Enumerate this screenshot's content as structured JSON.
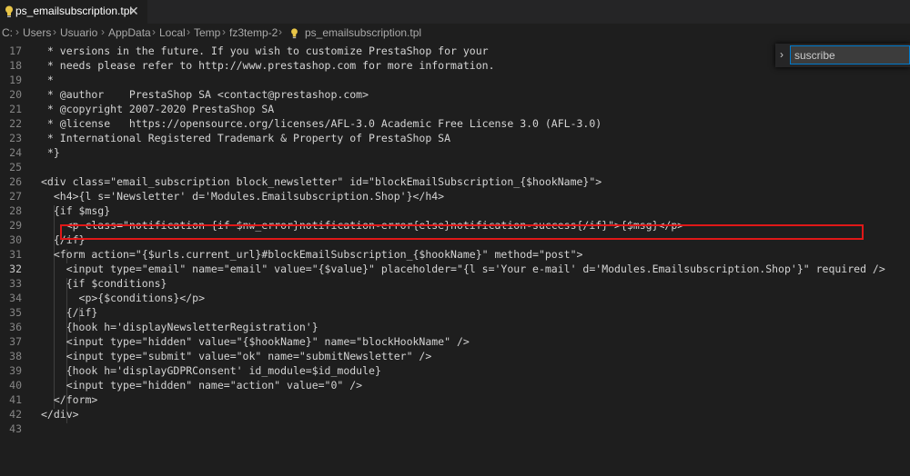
{
  "tab": {
    "label": "ps_emailsubscription.tpl",
    "close": "✕"
  },
  "breadcrumb": [
    "C:",
    "Users",
    "Usuario",
    "AppData",
    "Local",
    "Temp",
    "fz3temp-2",
    "ps_emailsubscription.tpl"
  ],
  "find": {
    "value": "suscribe",
    "toggle": "›"
  },
  "lines": [
    {
      "n": "17",
      "text": " * versions in the future. If you wish to customize PrestaShop for your"
    },
    {
      "n": "18",
      "text": " * needs please refer to http://www.prestashop.com for more information."
    },
    {
      "n": "19",
      "text": " *"
    },
    {
      "n": "20",
      "text": " * @author    PrestaShop SA <contact@prestashop.com>"
    },
    {
      "n": "21",
      "text": " * @copyright 2007-2020 PrestaShop SA"
    },
    {
      "n": "22",
      "text": " * @license   https://opensource.org/licenses/AFL-3.0 Academic Free License 3.0 (AFL-3.0)"
    },
    {
      "n": "23",
      "text": " * International Registered Trademark & Property of PrestaShop SA"
    },
    {
      "n": "24",
      "text": " *}"
    },
    {
      "n": "25",
      "text": ""
    },
    {
      "n": "26",
      "text": "<div class=\"email_subscription block_newsletter\" id=\"blockEmailSubscription_{$hookName}\">"
    },
    {
      "n": "27",
      "text": "  <h4>{l s='Newsletter' d='Modules.Emailsubscription.Shop'}</h4>"
    },
    {
      "n": "28",
      "text": "  {if $msg}"
    },
    {
      "n": "29",
      "text": "    <p class=\"notification {if $nw_error}notification-error{else}notification-success{/if}\">{$msg}</p>"
    },
    {
      "n": "30",
      "text": "  {/if}"
    },
    {
      "n": "31",
      "text": "  <form action=\"{$urls.current_url}#blockEmailSubscription_{$hookName}\" method=\"post\">"
    },
    {
      "n": "32",
      "text": "    <input type=\"email\" name=\"email\" value=\"{$value}\" placeholder=\"{l s='Your e-mail' d='Modules.Emailsubscription.Shop'}\" required />"
    },
    {
      "n": "33",
      "text": "    {if $conditions}"
    },
    {
      "n": "34",
      "text": "      <p>{$conditions}</p>"
    },
    {
      "n": "35",
      "text": "    {/if}"
    },
    {
      "n": "36",
      "text": "    {hook h='displayNewsletterRegistration'}"
    },
    {
      "n": "37",
      "text": "    <input type=\"hidden\" value=\"{$hookName}\" name=\"blockHookName\" />"
    },
    {
      "n": "38",
      "text": "    <input type=\"submit\" value=\"ok\" name=\"submitNewsletter\" />"
    },
    {
      "n": "39",
      "text": "    {hook h='displayGDPRConsent' id_module=$id_module}"
    },
    {
      "n": "40",
      "text": "    <input type=\"hidden\" name=\"action\" value=\"0\" />"
    },
    {
      "n": "41",
      "text": "  </form>"
    },
    {
      "n": "42",
      "text": "</div>"
    },
    {
      "n": "43",
      "text": ""
    }
  ]
}
